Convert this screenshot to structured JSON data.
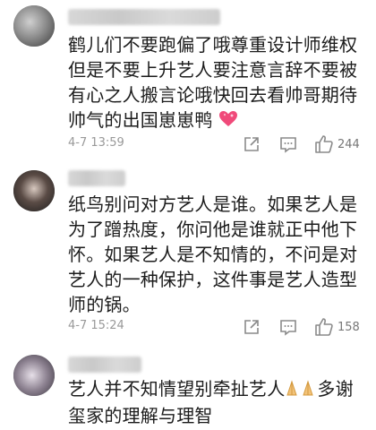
{
  "comments": [
    {
      "username": "",
      "text": "鹤儿们不要跑偏了哦尊重设计师维权但是不要上升艺人要注意言辞不要被有心之人搬言论哦快回去看帅哥期待帅气的出国崽崽鸭",
      "emoji": "sparkling-heart-icon",
      "date": "4-7 13:59",
      "likes": "244"
    },
    {
      "username": "",
      "text": "纸鸟别问对方艺人是谁。如果艺人是为了蹭热度，你问他是谁就正中他下怀。如果艺人是不知情的，不问是对艺人的一种保护，这件事是艺人造型师的锅。",
      "date": "4-7 15:24",
      "likes": "158"
    },
    {
      "username": "",
      "text_before": "艺人并不知情望别牵扯艺人",
      "emoji": "folded-hands-icon",
      "text_after": "多谢玺家的理解与理智"
    }
  ],
  "colors": {
    "text": "#1c1c1c",
    "meta": "#999999",
    "icon": "#8a8a8a",
    "heart": "#f04a7a"
  }
}
